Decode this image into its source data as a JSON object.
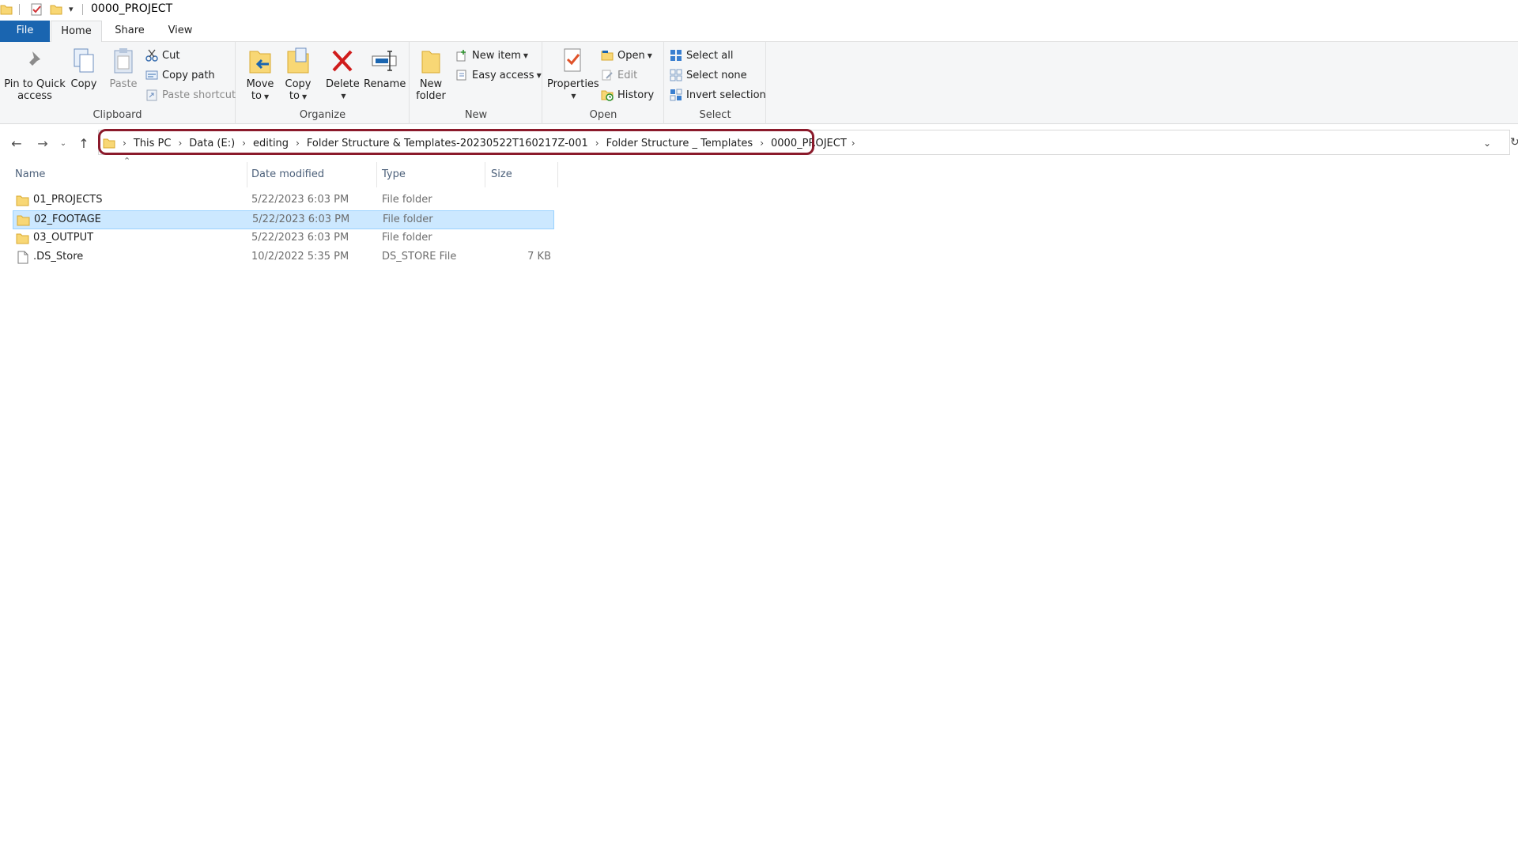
{
  "window": {
    "title": "0000_PROJECT"
  },
  "tabs": {
    "file": "File",
    "home": "Home",
    "share": "Share",
    "view": "View"
  },
  "ribbon": {
    "clipboard": {
      "label": "Clipboard",
      "pin_line1": "Pin to Quick",
      "pin_line2": "access",
      "copy": "Copy",
      "paste": "Paste",
      "cut": "Cut",
      "copy_path": "Copy path",
      "paste_shortcut": "Paste shortcut"
    },
    "organize": {
      "label": "Organize",
      "move_line1": "Move",
      "move_line2": "to",
      "copy_line1": "Copy",
      "copy_line2": "to",
      "delete": "Delete",
      "rename": "Rename"
    },
    "new": {
      "label": "New",
      "folder_line1": "New",
      "folder_line2": "folder",
      "new_item": "New item",
      "easy_access": "Easy access"
    },
    "open": {
      "label": "Open",
      "properties": "Properties",
      "open": "Open",
      "edit": "Edit",
      "history": "History"
    },
    "select": {
      "label": "Select",
      "select_all": "Select all",
      "select_none": "Select none",
      "invert": "Invert selection"
    }
  },
  "breadcrumbs": [
    "This PC",
    "Data (E:)",
    "editing",
    "Folder Structure & Templates-20230522T160217Z-001",
    "Folder Structure _ Templates",
    "0000_PROJECT"
  ],
  "columns": {
    "name": "Name",
    "date": "Date modified",
    "type": "Type",
    "size": "Size"
  },
  "files": [
    {
      "name": "01_PROJECTS",
      "date": "5/22/2023 6:03 PM",
      "type": "File folder",
      "size": "",
      "kind": "folder",
      "selected": false
    },
    {
      "name": "02_FOOTAGE",
      "date": "5/22/2023 6:03 PM",
      "type": "File folder",
      "size": "",
      "kind": "folder",
      "selected": true
    },
    {
      "name": "03_OUTPUT",
      "date": "5/22/2023 6:03 PM",
      "type": "File folder",
      "size": "",
      "kind": "folder",
      "selected": false
    },
    {
      "name": ".DS_Store",
      "date": "10/2/2022 5:35 PM",
      "type": "DS_STORE File",
      "size": "7 KB",
      "kind": "file",
      "selected": false
    }
  ],
  "colors": {
    "file_tab": "#1a65b0",
    "selection": "#cce8ff",
    "highlight_outline": "#8b1a2b",
    "folder": "#f8d775"
  }
}
